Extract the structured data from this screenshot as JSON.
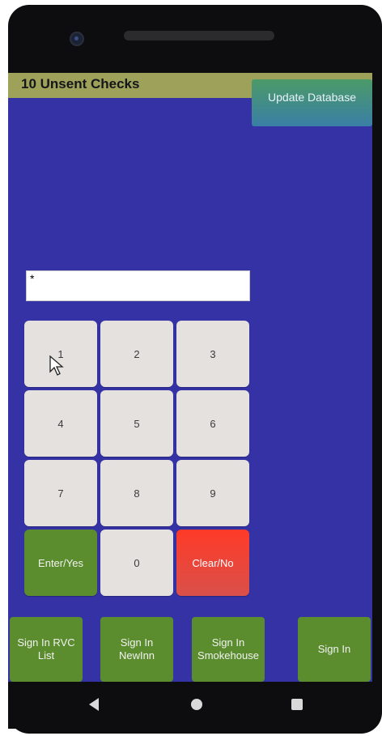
{
  "status_bar": {
    "title": "10 Unsent Checks"
  },
  "header": {
    "update_button": "Update Database"
  },
  "pin_input": {
    "value": "*"
  },
  "keypad": {
    "keys": [
      "1",
      "2",
      "3",
      "4",
      "5",
      "6",
      "7",
      "8",
      "9"
    ],
    "enter": "Enter/Yes",
    "zero": "0",
    "clear": "Clear/No"
  },
  "bottom_buttons": {
    "rvc_list": [
      "Sign In RVC",
      "List"
    ],
    "newinn": [
      "Sign In",
      "NewInn"
    ],
    "smokehouse": [
      "Sign In",
      "Smokehouse"
    ],
    "sign_in": "Sign In"
  },
  "colors": {
    "screen_bg": "#3532a6",
    "status_bar": "#9da15a",
    "green_button": "#5b8c2e",
    "clear_button": "#ff3a28",
    "key_bg": "#e4e1de"
  },
  "icons": {
    "nav_back": "back-triangle-icon",
    "nav_home": "home-circle-icon",
    "nav_recent": "recent-apps-square-icon",
    "cursor": "mouse-pointer-icon"
  }
}
